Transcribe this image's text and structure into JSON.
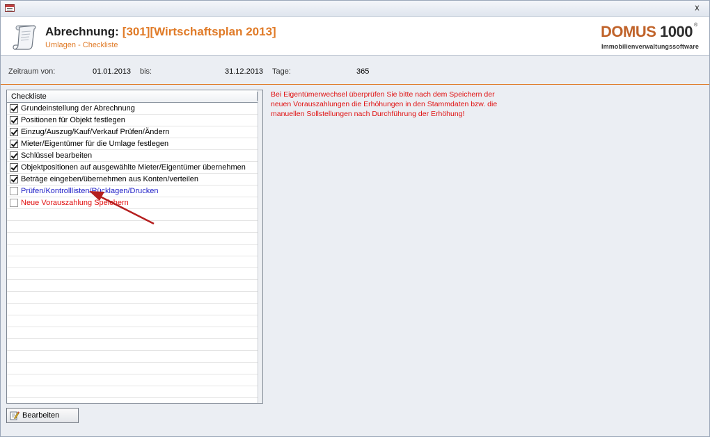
{
  "window": {
    "close_label": "x"
  },
  "header": {
    "title_label": "Abrechnung:",
    "title_value": "[301][Wirtschaftsplan 2013]",
    "subtitle": "Umlagen - Checkliste",
    "logo_text": "DOMUS",
    "logo_number": "1000",
    "logo_reg": "®",
    "logo_tagline": "Immobilienverwaltungssoftware",
    "accent_color": "#e07b28"
  },
  "period": {
    "from_label": "Zeitraum von:",
    "from_value": "01.01.2013",
    "to_label": "bis:",
    "to_value": "31.12.2013",
    "days_label": "Tage:",
    "days_value": "365"
  },
  "checklist": {
    "column_header": "Checkliste",
    "items": [
      {
        "label": "Grundeinstellung der Abrechnung",
        "checked": true,
        "color": "#000000"
      },
      {
        "label": "Positionen für Objekt festlegen",
        "checked": true,
        "color": "#000000"
      },
      {
        "label": "Einzug/Auszug/Kauf/Verkauf Prüfen/Ändern",
        "checked": true,
        "color": "#000000"
      },
      {
        "label": "Mieter/Eigentümer für die Umlage festlegen",
        "checked": true,
        "color": "#000000"
      },
      {
        "label": "Schlüssel bearbeiten",
        "checked": true,
        "color": "#000000"
      },
      {
        "label": "Objektpositionen auf ausgewählte Mieter/Eigentümer übernehmen",
        "checked": true,
        "color": "#000000"
      },
      {
        "label": "Beträge eingeben/übernehmen aus Konten/verteilen",
        "checked": true,
        "color": "#000000"
      },
      {
        "label": "Prüfen/Kontrolllisten/Rücklagen/Drucken",
        "checked": false,
        "color": "#2020c8"
      },
      {
        "label": "Neue Vorauszahlung Speichern",
        "checked": false,
        "color": "#e01010"
      }
    ]
  },
  "notice": {
    "text": "Bei Eigentümerwechsel überprüfen Sie bitte nach dem Speichern der neuen Vorauszahlungen die Erhöhungen in den Stammdaten bzw. die manuellen Sollstellungen nach Durchführung der Erhöhung!",
    "color": "#e01010"
  },
  "footer": {
    "edit_button_label": "Bearbeiten"
  },
  "icons": {
    "window": "form-window-icon",
    "header": "scroll-document-icon",
    "edit": "edit-pencil-icon",
    "annotation": "red-arrow-annotation"
  }
}
